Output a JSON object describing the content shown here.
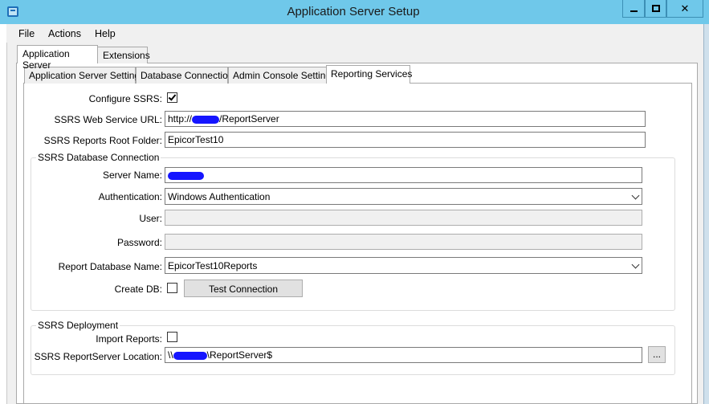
{
  "window": {
    "title": "Application Server Setup",
    "controls": {
      "minimize": "minimize",
      "maximize": "maximize",
      "close": "✕"
    }
  },
  "menu": [
    "File",
    "Actions",
    "Help"
  ],
  "outer_tabs": [
    "Application Server",
    "Extensions"
  ],
  "inner_tabs": [
    "Application Server Settings",
    "Database Connection",
    "Admin Console Settings",
    "Reporting Services"
  ],
  "form": {
    "configure_ssrs_label": "Configure SSRS:",
    "configure_ssrs_checked": true,
    "web_service_url_label": "SSRS Web Service URL:",
    "web_service_url_prefix": "http://",
    "web_service_url_suffix": "/ReportServer",
    "root_folder_label": "SSRS Reports Root Folder:",
    "root_folder_value": "EpicorTest10"
  },
  "db_group": {
    "title": "SSRS Database Connection",
    "server_name_label": "Server Name:",
    "authentication_label": "Authentication:",
    "authentication_value": "Windows Authentication",
    "user_label": "User:",
    "user_value": "",
    "password_label": "Password:",
    "password_value": "",
    "report_db_label": "Report Database Name:",
    "report_db_value": "EpicorTest10Reports",
    "create_db_label": "Create DB:",
    "create_db_checked": false,
    "test_connection_label": "Test Connection"
  },
  "deploy_group": {
    "title": "SSRS Deployment",
    "import_reports_label": "Import Reports:",
    "import_reports_checked": false,
    "location_label": "SSRS ReportServer Location:",
    "location_prefix": "\\\\",
    "location_suffix": "\\ReportServer$",
    "browse_label": "..."
  },
  "colors": {
    "titlebar": "#6fc8ea",
    "redaction": "#1515ff"
  }
}
